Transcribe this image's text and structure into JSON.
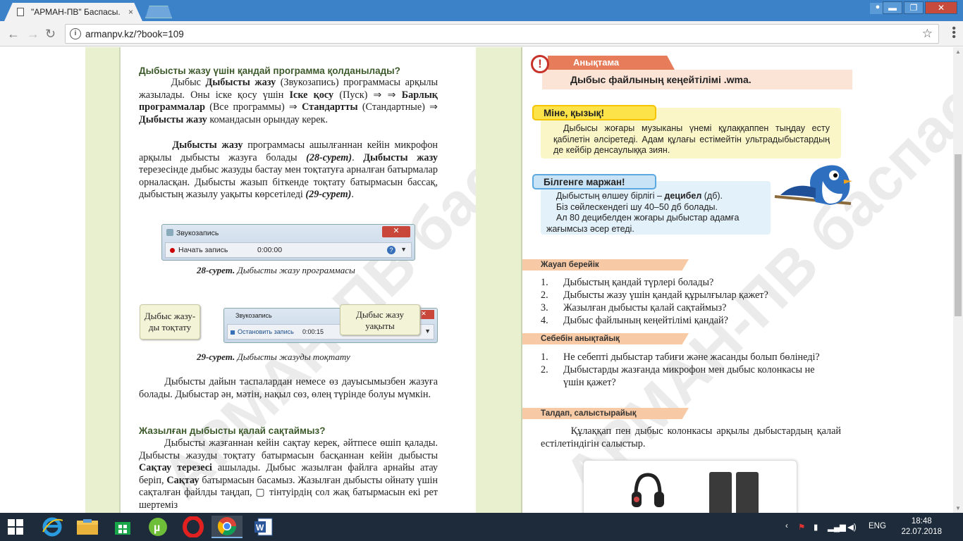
{
  "browser": {
    "tab_title": "\"АРМАН-ПВ\" Баспасы. К",
    "tab_close": "×",
    "url": "armanpv.kz/?book=109",
    "win_minimize": "▬",
    "win_restore": "❐",
    "win_close": "✕",
    "user_icon": "user-icon"
  },
  "left_page": {
    "heading1": "Дыбысты жазу үшін қандай программа қолданылады?",
    "para1_html": "&nbsp;&nbsp;&nbsp;&nbsp;&nbsp;&nbsp;&nbsp;Дыбыс <b>Дыбысты жазу</b> (Звукозапись) программасы арқылы жазылады. Оны іске қосу үшін <b>Іске қосу</b> (Пуск) ⇒ ⇒ <b>Барлық программалар</b> (Все программы) ⇒ <b>Стандартты</b> (Стандартные) ⇒ <b>Дыбысты жазу</b> командасын орындау керек.",
    "para2_html": "&nbsp;&nbsp;&nbsp;&nbsp;&nbsp;&nbsp;&nbsp;<b>Дыбысты жазу</b> программасы ашылғаннан кейін микрофон арқылы дыбысты жазуға болады <b><i>(28-сурет)</i></b>. <b>Дыбысты жазу</b> терезесінде дыбыс жазуды бастау мен тоқтатуға арналған батырмалар орналасқан. Дыбысты жазып біткенде тоқтату батырмасын бассақ, дыбыстың жазылу уақыты көрсетіледі <b><i>(29-сурет)</i></b>.",
    "win1": {
      "title": "Звукозапись",
      "button": "Начать запись",
      "time": "0:00:00",
      "close": "✕"
    },
    "caption28": "28-сурет.",
    "caption28_text": " Дыбысты жазу программасы",
    "win2": {
      "title": "Звукозапись",
      "button": "Остановить запись",
      "time": "0:00:15",
      "close": "✕"
    },
    "callout_left": "Дыбыс жазу-\nды тоқтату",
    "callout_right": "Дыбыс жазу\nуақыты",
    "caption29": "29-сурет.",
    "caption29_text": " Дыбысты жазуды тоқтату",
    "para3": "       Дыбысты дайын таспалардан немесе өз дауысымызбен жазуға болады. Дыбыстар ән, мәтін, нақыл сөз, өлең түрінде болуы мүмкін.",
    "heading2": "Жазылған дыбысты қалай сақтаймыз?",
    "para4_html": "&nbsp;&nbsp;&nbsp;&nbsp;&nbsp;&nbsp;&nbsp;Дыбысты жазғаннан кейін сақтау керек, әйтпесе өшіп қалады. Дыбысты жазуды тоқтату батырмасын басқаннан кейін дыбысты <b>Сақтау терезесі</b> ашылады. Дыбыс жазылған файлға арнайы атау беріп, <b>Сақтау</b> батырмасын басамыз. Жазылған дыбысты ойнату үшін сақталған файлды таңдап, ▢ тінтуірдің сол жақ батырмасын екі рет шертеміз",
    "watermark": "АРМАН-ПВ баспасы"
  },
  "right_page": {
    "anyktama_label": "Анықтама",
    "anyktama_text": "Дыбыс файлының кеңейтілімі .wma.",
    "mine_label": "Міне, қызық!",
    "mine_text": "Дыбысы жоғары музыканы үнемі құлаққаппен тыңдау есту қабілетін әлсіретеді. Адам құлағы естімейтін ультрадыбыстардың де кейбір денсаулыққа зиян.",
    "bilgenge_label": "Білгенге маржан!",
    "bilgenge_html": "&nbsp;&nbsp;&nbsp;&nbsp;Дыбыстың өлшеу бірлігі – <b>децибел</b> (дб).<br>&nbsp;&nbsp;&nbsp;&nbsp;Біз сөйлескендегі шу 40–50 дб болады.<br>&nbsp;&nbsp;&nbsp;&nbsp;Ал 80 децибелден жоғары дыбыстар адамға жағымсыз әсер етеді.",
    "sec1": "Жауап берейік",
    "list1": [
      {
        "n": "1.",
        "t": "Дыбыстың қандай түрлері болады?"
      },
      {
        "n": "2.",
        "t": "Дыбысты жазу үшін қандай құрылғылар қажет?"
      },
      {
        "n": "3.",
        "t": "Жазылған дыбысты қалай сақтаймыз?"
      },
      {
        "n": "4.",
        "t": "Дыбыс файлының кеңейтілімі қандай?"
      }
    ],
    "sec2": "Себебін анықтайық",
    "list2": [
      {
        "n": "1.",
        "t": "Не себепті дыбыстар табиғи және жасанды болып бөлінеді?"
      },
      {
        "n": "2.",
        "t": "Дыбыстарды жазғанда микрофон мен дыбыс колонкасы не үшін қажет?"
      }
    ],
    "sec3": "Талдап, салыстырайық",
    "para_compare": "       Құлаққап пен дыбыс колонкасы арқылы дыбыстардың қалай естілетіндігін салыстыр.",
    "watermark": "АРМАН-ПВ баспасы"
  },
  "taskbar": {
    "lang": "ENG",
    "time": "18:48",
    "date": "22.07.2018"
  }
}
